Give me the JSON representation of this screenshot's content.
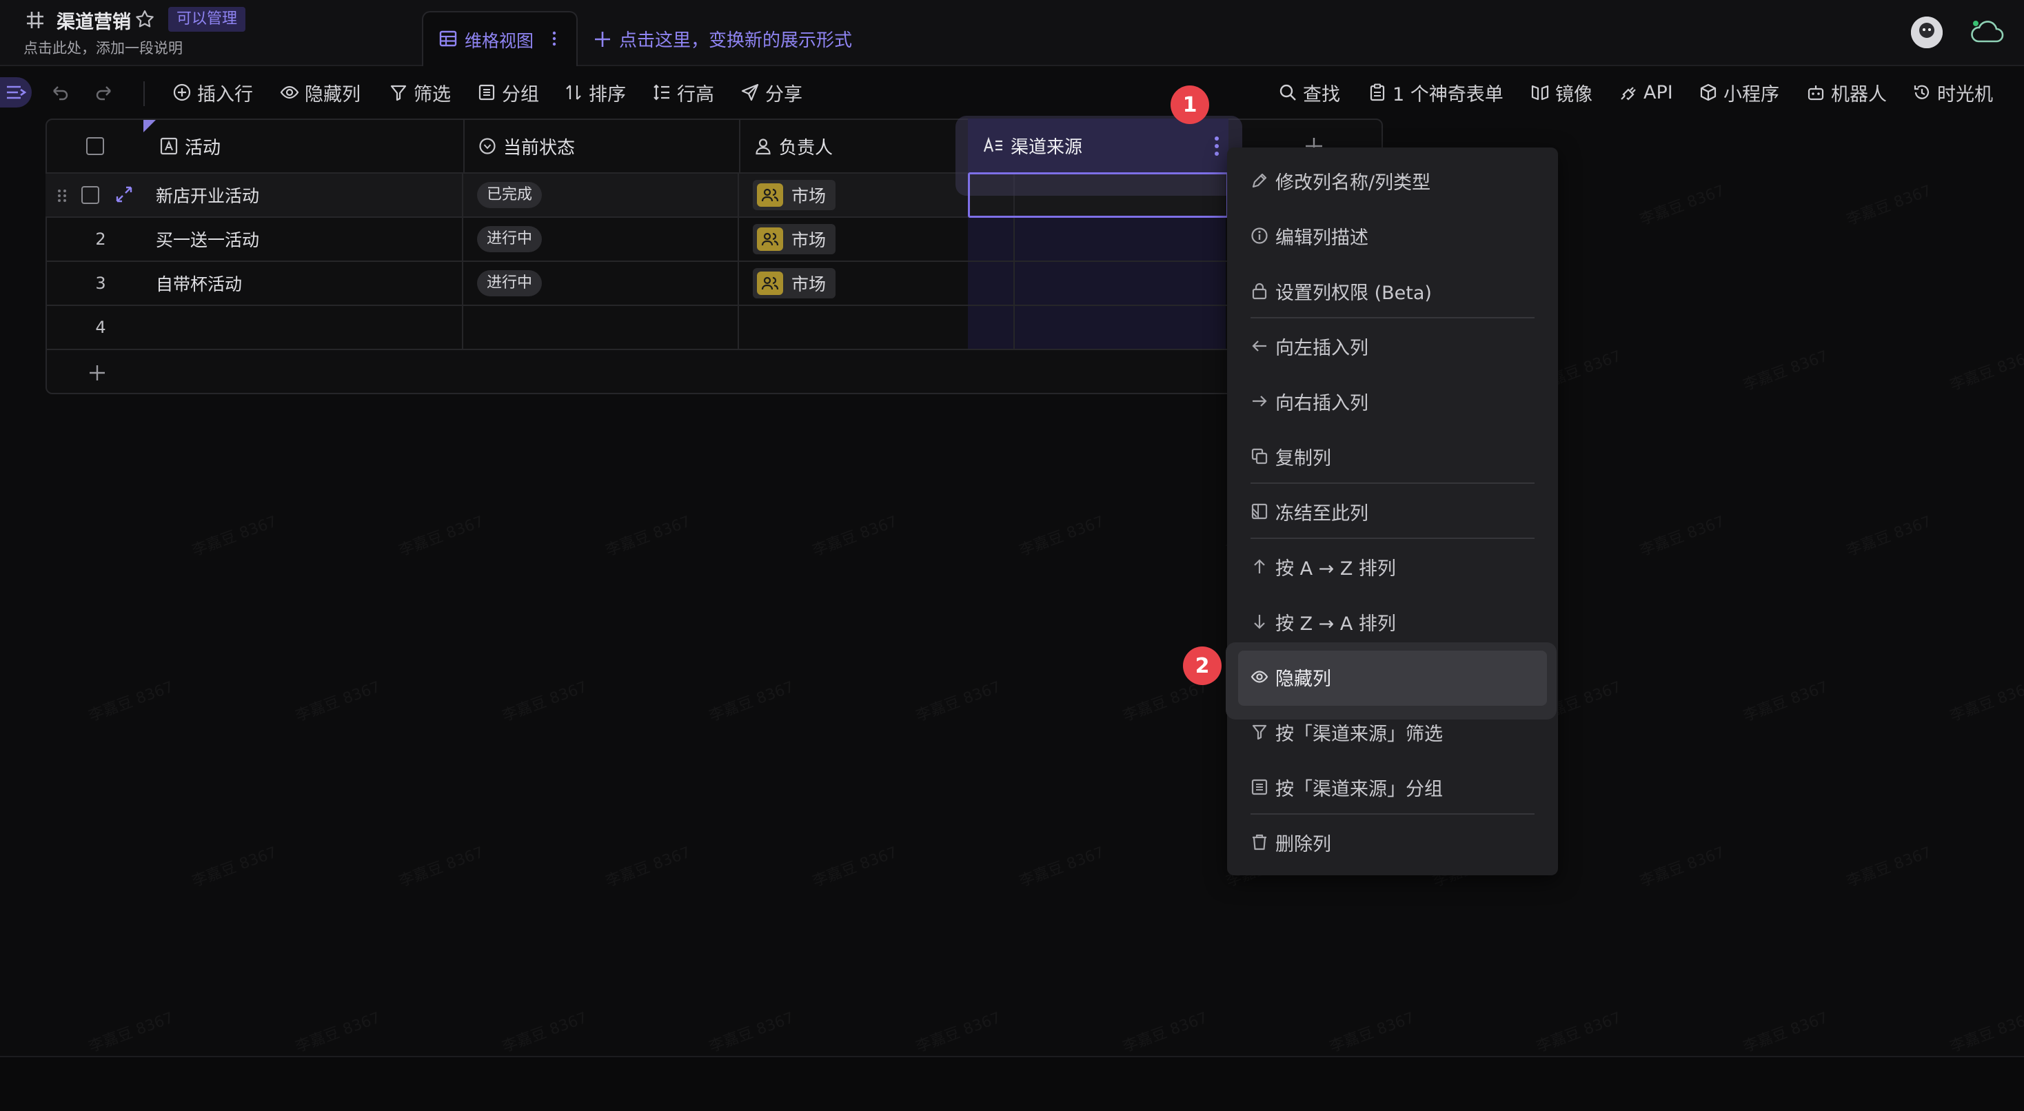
{
  "header": {
    "title": "渠道营销",
    "badge": "可以管理",
    "subtitle": "点击此处，添加一段说明",
    "view_tab": "维格视图",
    "add_view": "点击这里，变换新的展示形式"
  },
  "toolbar": {
    "insert_row": "插入行",
    "hide_columns": "隐藏列",
    "filter": "筛选",
    "group": "分组",
    "sort": "排序",
    "row_height": "行高",
    "share": "分享",
    "find": "查找",
    "forms": "1 个神奇表单",
    "mirror": "镜像",
    "api": "API",
    "mini_program": "小程序",
    "robot": "机器人",
    "time_machine": "时光机"
  },
  "table": {
    "columns": [
      "活动",
      "当前状态",
      "负责人",
      "渠道来源"
    ],
    "rows": [
      {
        "num": "",
        "activity": "新店开业活动",
        "status": "已完成",
        "owner": "市场"
      },
      {
        "num": "2",
        "activity": "买一送一活动",
        "status": "进行中",
        "owner": "市场"
      },
      {
        "num": "3",
        "activity": "自带杯活动",
        "status": "进行中",
        "owner": "市场"
      },
      {
        "num": "4",
        "activity": "",
        "status": "",
        "owner": ""
      }
    ]
  },
  "steps": {
    "one": "1",
    "two": "2"
  },
  "menu": {
    "items": [
      "修改列名称/列类型",
      "编辑列描述",
      "设置列权限 (Beta)",
      "向左插入列",
      "向右插入列",
      "复制列",
      "冻结至此列",
      "按 A → Z 排列",
      "按 Z → A 排列",
      "隐藏列",
      "按「渠道来源」筛选",
      "按「渠道来源」分组",
      "删除列"
    ]
  },
  "watermark": "李嘉豆 8367",
  "colors": {
    "accent": "#7e70e8",
    "badge_red": "#e9434a",
    "owner_icon": "#a88f2d"
  }
}
